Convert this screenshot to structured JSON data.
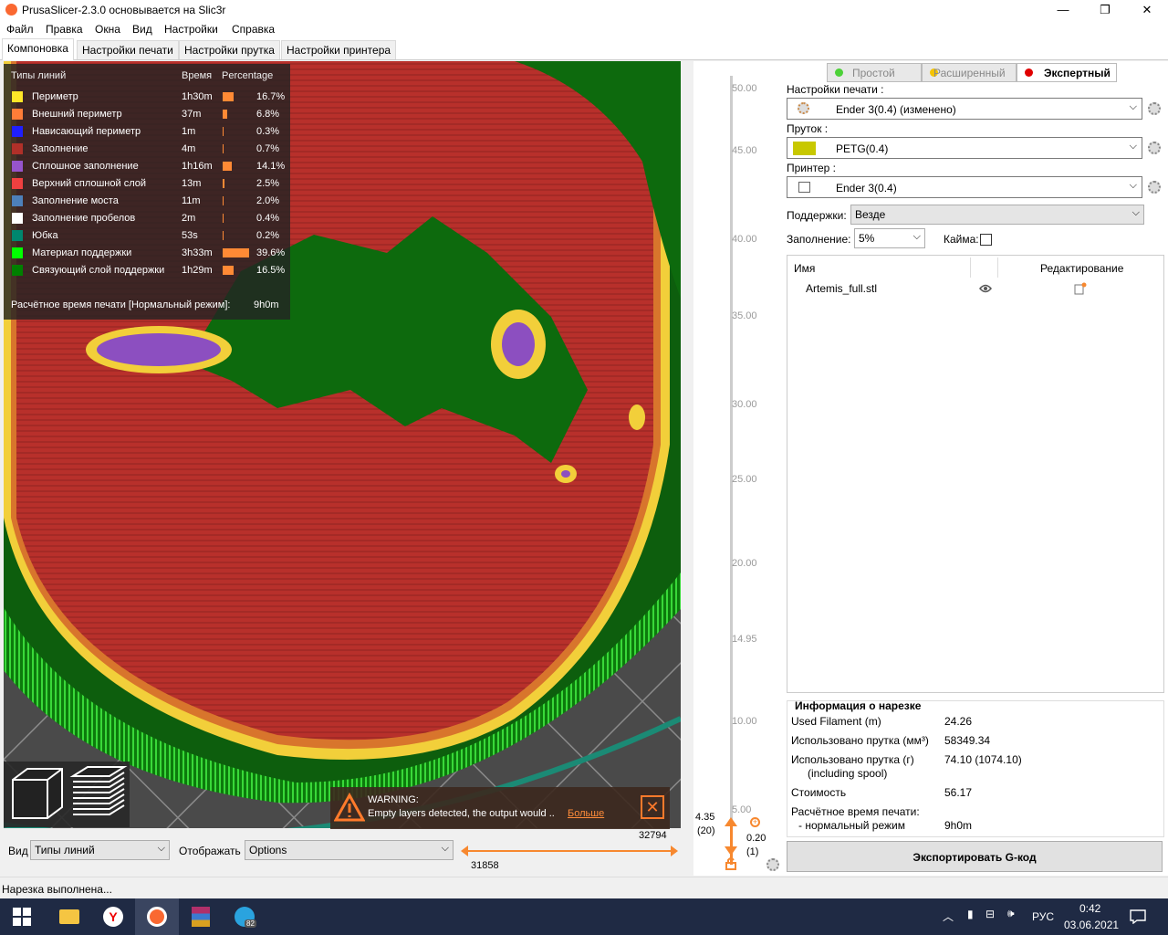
{
  "window": {
    "title": "PrusaSlicer-2.3.0 основывается на Slic3r",
    "controls": {
      "minimize": "—",
      "maximize": "❐",
      "close": "✕"
    }
  },
  "menu": [
    "Файл",
    "Правка",
    "Окна",
    "Вид",
    "Настройки",
    "Справка"
  ],
  "tabs": [
    "Компоновка",
    "Настройки печати",
    "Настройки прутка",
    "Настройки принтера"
  ],
  "legend": {
    "col_type": "Типы линий",
    "col_time": "Время",
    "col_pct": "Percentage",
    "rows": [
      {
        "name": "Периметр",
        "time": "1h30m",
        "pct": "16.7%",
        "value": 16.7,
        "color": "#ffe628"
      },
      {
        "name": "Внешний периметр",
        "time": "37m",
        "pct": "6.8%",
        "value": 6.8,
        "color": "#ff7d38"
      },
      {
        "name": "Нависающий периметр",
        "time": "1m",
        "pct": "0.3%",
        "value": 0.3,
        "color": "#1f1fff"
      },
      {
        "name": "Заполнение",
        "time": "4m",
        "pct": "0.7%",
        "value": 0.7,
        "color": "#b03029"
      },
      {
        "name": "Сплошное заполнение",
        "time": "1h16m",
        "pct": "14.1%",
        "value": 14.1,
        "color": "#9654cc"
      },
      {
        "name": "Верхний сплошной слой",
        "time": "13m",
        "pct": "2.5%",
        "value": 2.5,
        "color": "#f04040"
      },
      {
        "name": "Заполнение моста",
        "time": "11m",
        "pct": "2.0%",
        "value": 2.0,
        "color": "#4d80ba"
      },
      {
        "name": "Заполнение пробелов",
        "time": "2m",
        "pct": "0.4%",
        "value": 0.4,
        "color": "#ffffff"
      },
      {
        "name": "Юбка",
        "time": "53s",
        "pct": "0.2%",
        "value": 0.2,
        "color": "#00876e"
      },
      {
        "name": "Материал поддержки",
        "time": "3h33m",
        "pct": "39.6%",
        "value": 39.6,
        "color": "#00ff00"
      },
      {
        "name": "Связующий слой поддержки",
        "time": "1h29m",
        "pct": "16.5%",
        "value": 16.5,
        "color": "#008000"
      }
    ],
    "estimated_label": "Расчётное время печати [Нормальный режим]:",
    "estimated_value": "9h0m"
  },
  "warning": {
    "title": "WARNING:",
    "text": "Empty layers detected, the output would ..",
    "link": "Больше"
  },
  "bottom": {
    "view_label": "Вид",
    "view_value": "Типы линий",
    "show_label": "Отображать",
    "show_value": "Options",
    "hslider_left": "31858",
    "hslider_right": "32794"
  },
  "vslider": {
    "ticks": [
      "50.00",
      "45.00",
      "40.00",
      "35.00",
      "30.00",
      "25.00",
      "20.00",
      "14.95",
      "10.00",
      "5.00"
    ],
    "upper_value": "4.35",
    "upper_layer": "(20)",
    "lower_value": "0.20",
    "lower_layer": "(1)"
  },
  "modes": [
    {
      "label": "Простой",
      "color": "#4cd137"
    },
    {
      "label": "Расширенный",
      "color": "#f5c400"
    },
    {
      "label": "Экспертный",
      "color": "#e00000"
    }
  ],
  "presets": {
    "print_label": "Настройки печати :",
    "print_value": "Ender 3(0.4) (изменено)",
    "filament_label": "Пруток :",
    "filament_value": "PETG(0.4)",
    "filament_color": "#c8c800",
    "printer_label": "Принтер :",
    "printer_value": "Ender 3(0.4)",
    "supports_label": "Поддержки:",
    "supports_value": "Везде",
    "infill_label": "Заполнение:",
    "infill_value": "5%",
    "brim_label": "Кайма:"
  },
  "objects": {
    "col_name": "Имя",
    "col_edit": "Редактирование",
    "items": [
      {
        "name": "Artemis_full.stl"
      }
    ]
  },
  "slice_info": {
    "title": "Информация о нарезке",
    "rows": [
      {
        "label": "Used Filament (m)",
        "value": "24.26"
      },
      {
        "label": "Использовано прутка (мм³)",
        "value": "58349.34"
      },
      {
        "label": "Использовано прутка (г)",
        "label2": "(including spool)",
        "value": "74.10 (1074.10)"
      },
      {
        "label": "Стоимость",
        "value": "56.17"
      },
      {
        "label": "Расчётное время печати:",
        "label2": "- нормальный режим",
        "value": "9h0m"
      }
    ]
  },
  "export_button": "Экспортировать G-код",
  "status": "Нарезка выполнена...",
  "taskbar": {
    "lang": "РУС",
    "time": "0:42",
    "date": "03.06.2021",
    "telegram_badge": "82"
  }
}
